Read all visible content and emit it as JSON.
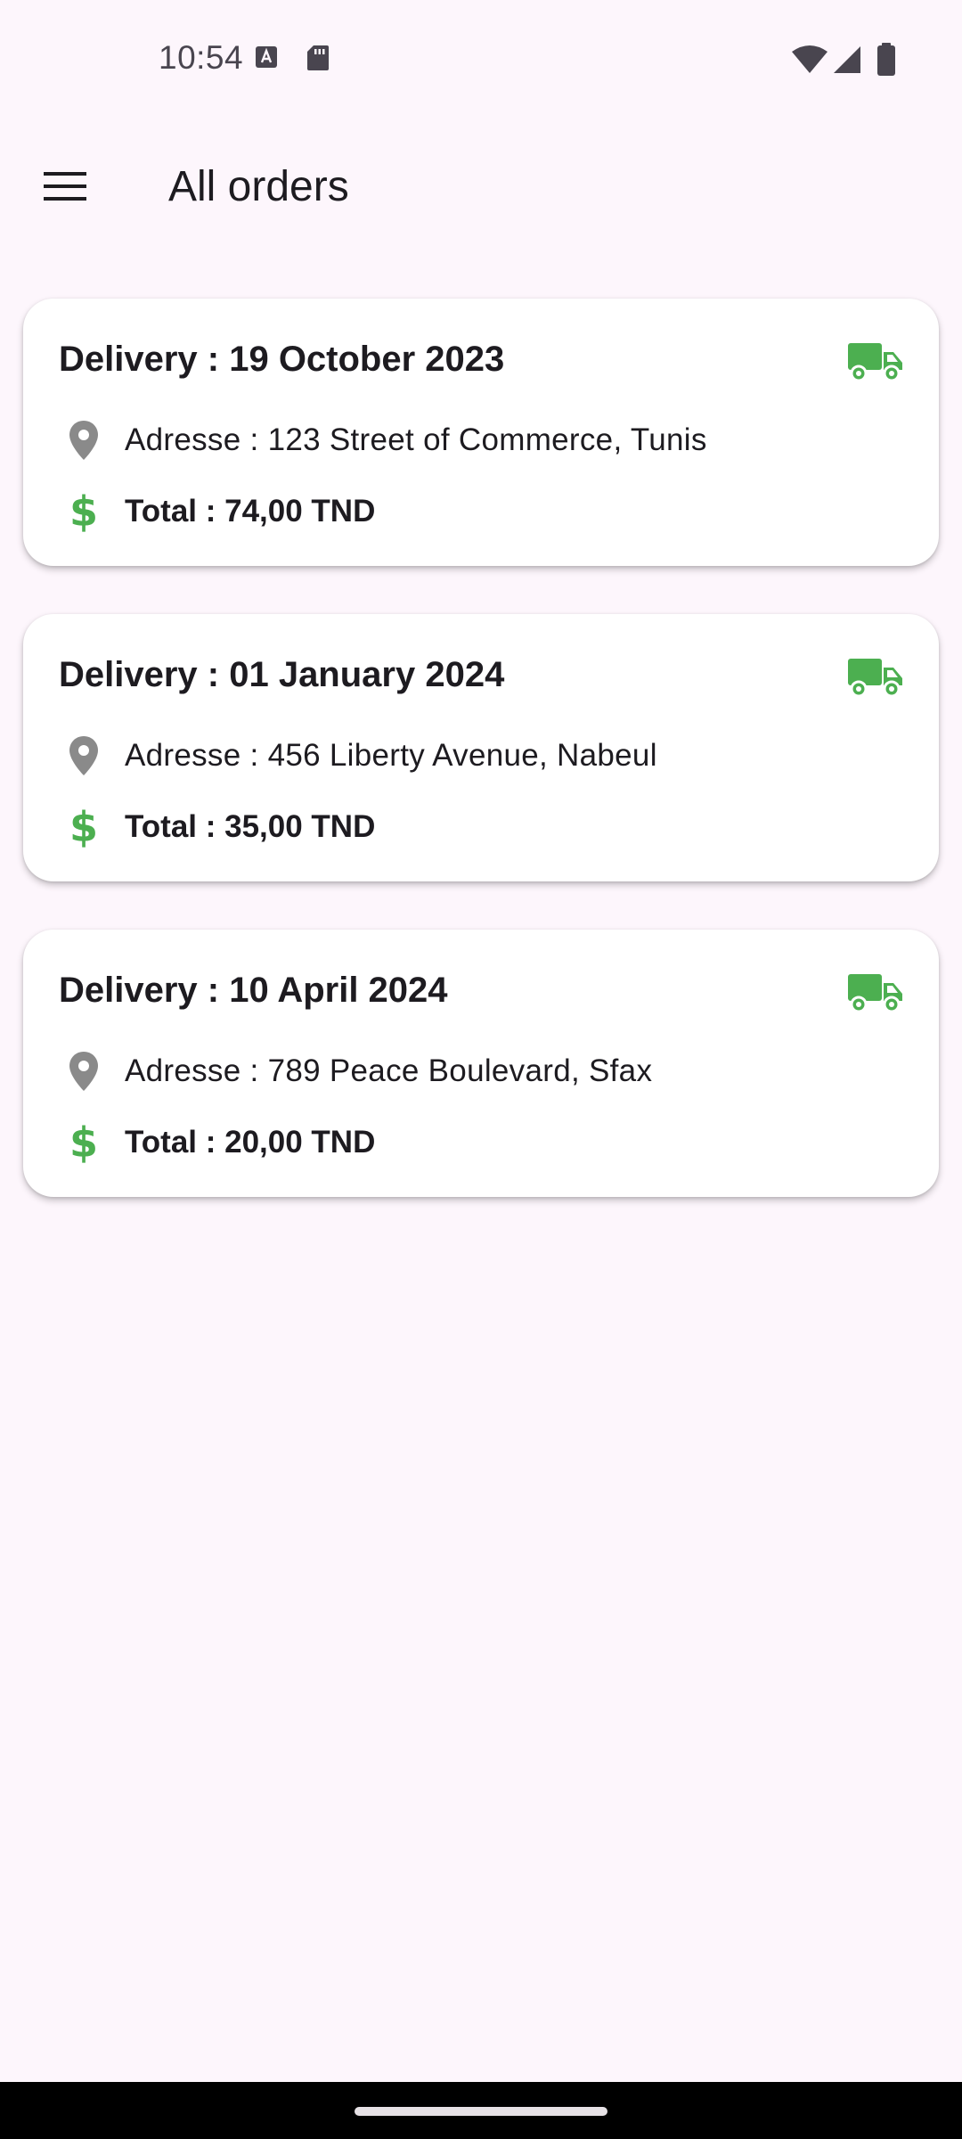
{
  "status_bar": {
    "time": "10:54"
  },
  "app_bar": {
    "title": "All orders",
    "menu_icon": "menu-icon"
  },
  "colors": {
    "accent_green": "#4caf50",
    "pin_gray": "#8a8a8a",
    "background": "#fdf6fc"
  },
  "orders": [
    {
      "title": "Delivery : 19 October 2023",
      "address": "Adresse : 123 Street of Commerce, Tunis",
      "total": "Total : 74,00 TND",
      "dollar": "$"
    },
    {
      "title": "Delivery : 01 January 2024",
      "address": "Adresse : 456 Liberty Avenue, Nabeul",
      "total": "Total : 35,00 TND",
      "dollar": "$"
    },
    {
      "title": "Delivery : 10 April 2024",
      "address": "Adresse : 789 Peace Boulevard, Sfax",
      "total": "Total : 20,00 TND",
      "dollar": "$"
    }
  ]
}
